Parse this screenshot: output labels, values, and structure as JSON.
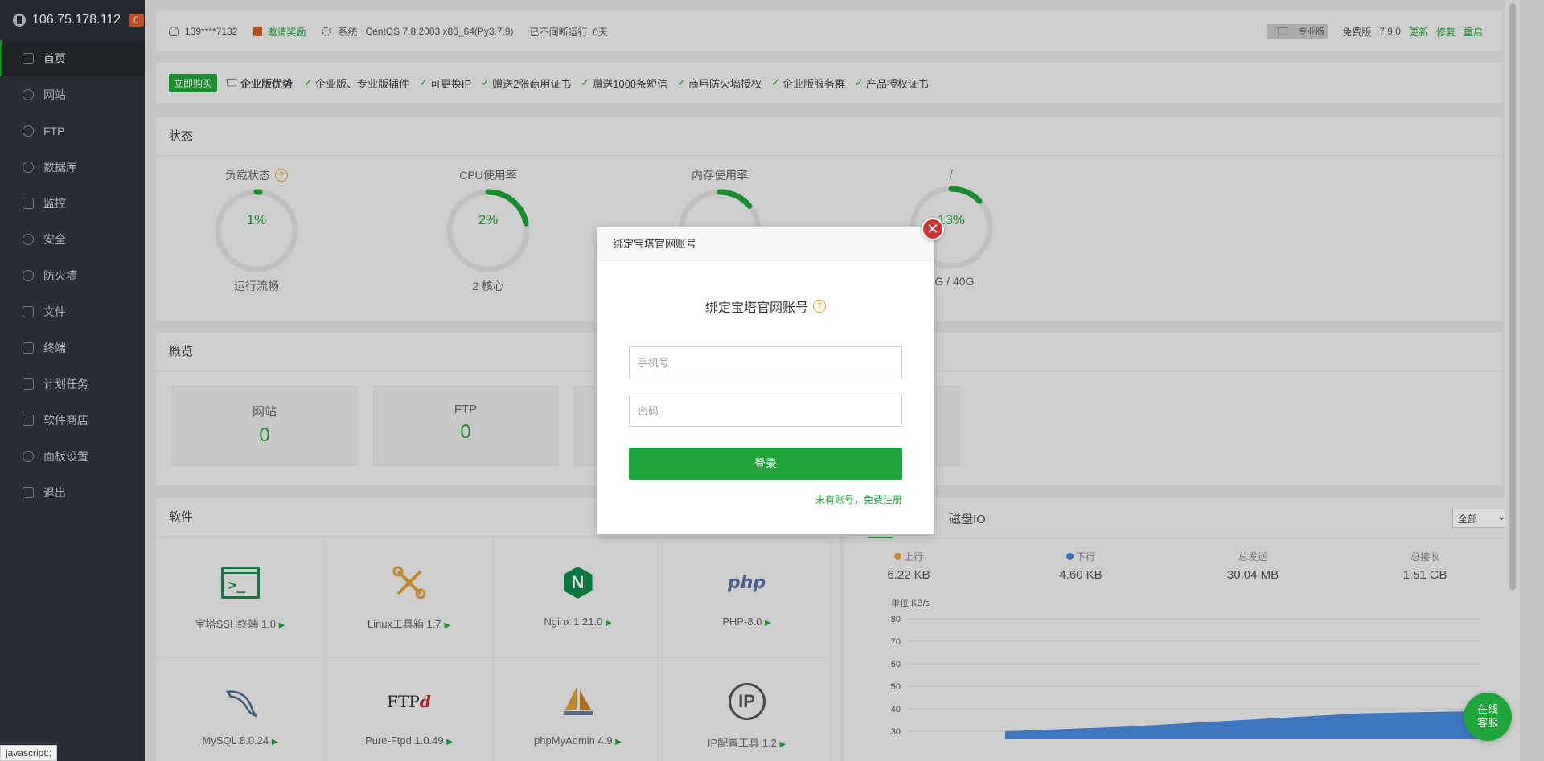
{
  "sidebar": {
    "server_ip": "106.75.178.112",
    "badge": "0",
    "items": [
      {
        "label": "首页",
        "icon": "home-icon"
      },
      {
        "label": "网站",
        "icon": "globe-icon"
      },
      {
        "label": "FTP",
        "icon": "ftp-icon"
      },
      {
        "label": "数据库",
        "icon": "database-icon"
      },
      {
        "label": "监控",
        "icon": "monitor-icon"
      },
      {
        "label": "安全",
        "icon": "shield-icon"
      },
      {
        "label": "防火墙",
        "icon": "firewall-icon"
      },
      {
        "label": "文件",
        "icon": "folder-icon"
      },
      {
        "label": "终端",
        "icon": "terminal-icon"
      },
      {
        "label": "计划任务",
        "icon": "calendar-icon"
      },
      {
        "label": "软件商店",
        "icon": "grid-icon"
      },
      {
        "label": "面板设置",
        "icon": "gear-icon"
      },
      {
        "label": "退出",
        "icon": "logout-icon"
      }
    ]
  },
  "topbar": {
    "user": "139****7132",
    "invite": "邀请奖励",
    "system_label": "系统:",
    "system_value": "CentOS 7.8.2003 x86_64(Py3.7.9)",
    "uptime": "已不间断运行: 0天",
    "pro_tag": "专业版",
    "edition": "免费版",
    "version": "7.9.0",
    "update": "更新",
    "repair": "修复",
    "restart": "重启"
  },
  "promo": {
    "buy": "立即购买",
    "enterprise": "企业版优势",
    "features": [
      "企业版、专业版插件",
      "可更换IP",
      "赠送2张商用证书",
      "赠送1000条短信",
      "商用防火墙授权",
      "企业版服务群",
      "产品授权证书"
    ]
  },
  "status": {
    "title": "状态",
    "gauges": [
      {
        "label": "负载状态",
        "value": "1%",
        "sub": "运行流畅",
        "fraction": 0.01
      },
      {
        "label": "CPU使用率",
        "value": "2%",
        "sub": "2 核心",
        "fraction": 0.22
      },
      {
        "label": "内存使用率",
        "value": "",
        "sub": "",
        "fraction": 0.14
      },
      {
        "label": "/",
        "value": "13%",
        "sub": "2G / 40G",
        "fraction": 0.13
      }
    ]
  },
  "overview": {
    "title": "概览",
    "cards": [
      {
        "label": "网站",
        "value": "0"
      },
      {
        "label": "FTP",
        "value": "0"
      }
    ]
  },
  "software": {
    "title": "软件",
    "items": [
      {
        "label": "宝塔SSH终端 1.0",
        "icon": "terminal-icon"
      },
      {
        "label": "Linux工具箱 1.7",
        "icon": "tools-icon"
      },
      {
        "label": "Nginx 1.21.0",
        "icon": "nginx-icon"
      },
      {
        "label": "PHP-8.0",
        "icon": "php-icon"
      },
      {
        "label": "MySQL 8.0.24",
        "icon": "mysql-dolphin-icon"
      },
      {
        "label": "Pure-Ftpd 1.0.49",
        "icon": "ftp-icon"
      },
      {
        "label": "phpMyAdmin 4.9",
        "icon": "sailboat-icon"
      },
      {
        "label": "IP配置工具 1.2",
        "icon": "ip-icon"
      }
    ],
    "php_text": "php",
    "nginx_letter": "N",
    "ftp_text": "FTP",
    "ftp_d": "d",
    "ip_text": "IP"
  },
  "traffic": {
    "disk_tab": "磁盘IO",
    "select": "全部",
    "stats": [
      {
        "label": "上行",
        "value": "6.22 KB",
        "dot": "#e0a040"
      },
      {
        "label": "下行",
        "value": "4.60 KB",
        "dot": "#4a80e0"
      },
      {
        "label": "总发送",
        "value": "30.04 MB"
      },
      {
        "label": "总接收",
        "value": "1.51 GB"
      }
    ],
    "chart_data": {
      "type": "area",
      "ylabel": "单位:KB/s",
      "ylim": [
        30,
        80
      ],
      "yticks": [
        "80",
        "70",
        "60",
        "50",
        "40",
        "30"
      ],
      "series": [
        {
          "values": [
            30,
            32,
            35,
            38,
            39
          ]
        }
      ]
    }
  },
  "modal": {
    "header": "绑定宝塔官网账号",
    "title": "绑定宝塔官网账号",
    "phone_placeholder": "手机号",
    "password_placeholder": "密码",
    "login": "登录",
    "register": "未有账号，免费注册",
    "close": "✕"
  },
  "chat": {
    "line1": "在线",
    "line2": "客服"
  },
  "statusbar": "javascript:;"
}
